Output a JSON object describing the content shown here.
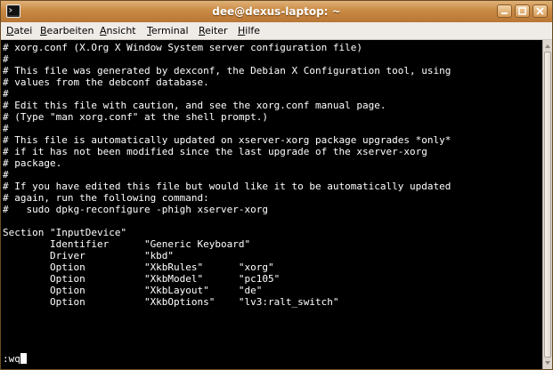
{
  "window": {
    "title": "dee@dexus-laptop: ~"
  },
  "menu": [
    {
      "accel": "D",
      "rest": "atei"
    },
    {
      "accel": "B",
      "rest": "earbeiten"
    },
    {
      "accel": "A",
      "rest": "nsicht"
    },
    {
      "accel": "T",
      "rest": "erminal"
    },
    {
      "accel": "R",
      "rest": "eiter"
    },
    {
      "accel": "H",
      "rest": "ilfe"
    }
  ],
  "terminal": {
    "lines": [
      "# xorg.conf (X.Org X Window System server configuration file)",
      "#",
      "# This file was generated by dexconf, the Debian X Configuration tool, using",
      "# values from the debconf database.",
      "#",
      "# Edit this file with caution, and see the xorg.conf manual page.",
      "# (Type \"man xorg.conf\" at the shell prompt.)",
      "#",
      "# This file is automatically updated on xserver-xorg package upgrades *only*",
      "# if it has not been modified since the last upgrade of the xserver-xorg",
      "# package.",
      "#",
      "# If you have edited this file but would like it to be automatically updated",
      "# again, run the following command:",
      "#   sudo dpkg-reconfigure -phigh xserver-xorg",
      "",
      "Section \"InputDevice\"",
      "        Identifier      \"Generic Keyboard\"",
      "        Driver          \"kbd\"",
      "        Option          \"XkbRules\"      \"xorg\"",
      "        Option          \"XkbModel\"      \"pc105\"",
      "        Option          \"XkbLayout\"     \"de\"",
      "        Option          \"XkbOptions\"    \"lv3:ralt_switch\""
    ],
    "command": ":wq"
  },
  "icons": {
    "window": "terminal-icon",
    "minimize": "minimize-icon",
    "maximize": "maximize-icon",
    "close": "close-icon"
  }
}
